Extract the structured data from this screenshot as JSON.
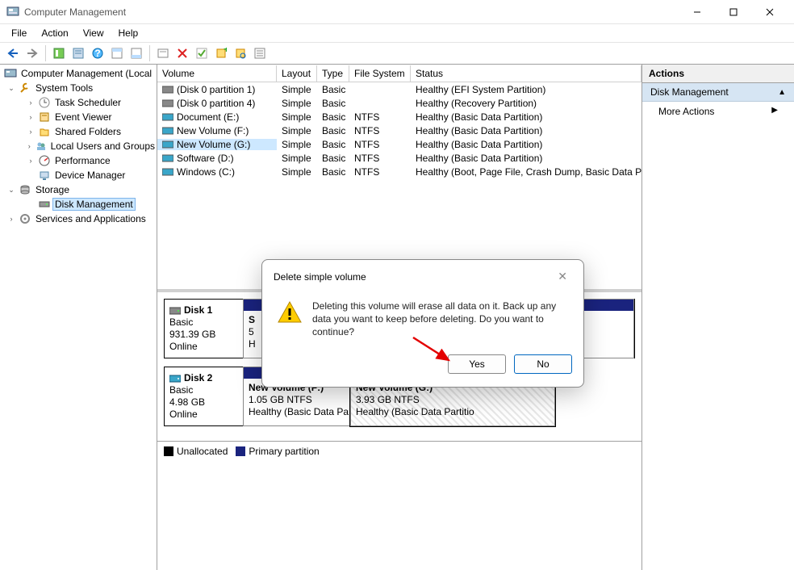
{
  "window": {
    "title": "Computer Management"
  },
  "menu": {
    "file": "File",
    "action": "Action",
    "view": "View",
    "help": "Help"
  },
  "tree": {
    "root": "Computer Management (Local",
    "systools": "System Tools",
    "taskscheduler": "Task Scheduler",
    "eventviewer": "Event Viewer",
    "sharedfolders": "Shared Folders",
    "localusers": "Local Users and Groups",
    "performance": "Performance",
    "devicemgr": "Device Manager",
    "storage": "Storage",
    "diskmgmt": "Disk Management",
    "services": "Services and Applications"
  },
  "cols": {
    "volume": "Volume",
    "layout": "Layout",
    "type": "Type",
    "fs": "File System",
    "status": "Status"
  },
  "vols": [
    {
      "name": "(Disk 0 partition 1)",
      "layout": "Simple",
      "type": "Basic",
      "fs": "",
      "status": "Healthy (EFI System Partition)",
      "icon": "drive"
    },
    {
      "name": "(Disk 0 partition 4)",
      "layout": "Simple",
      "type": "Basic",
      "fs": "",
      "status": "Healthy (Recovery Partition)",
      "icon": "drive"
    },
    {
      "name": "Document (E:)",
      "layout": "Simple",
      "type": "Basic",
      "fs": "NTFS",
      "status": "Healthy (Basic Data Partition)",
      "icon": "vol"
    },
    {
      "name": "New Volume (F:)",
      "layout": "Simple",
      "type": "Basic",
      "fs": "NTFS",
      "status": "Healthy (Basic Data Partition)",
      "icon": "vol"
    },
    {
      "name": "New Volume (G:)",
      "layout": "Simple",
      "type": "Basic",
      "fs": "NTFS",
      "status": "Healthy (Basic Data Partition)",
      "icon": "vol",
      "sel": true
    },
    {
      "name": "Software (D:)",
      "layout": "Simple",
      "type": "Basic",
      "fs": "NTFS",
      "status": "Healthy (Basic Data Partition)",
      "icon": "vol"
    },
    {
      "name": "Windows (C:)",
      "layout": "Simple",
      "type": "Basic",
      "fs": "NTFS",
      "status": "Healthy (Boot, Page File, Crash Dump, Basic Data Partition)",
      "icon": "vol"
    }
  ],
  "disks": {
    "d1": {
      "name": "Disk 1",
      "type": "Basic",
      "size": "931.39 GB",
      "state": "Online",
      "p1": {
        "name": "S",
        "line2": "5",
        "line3": "H"
      }
    },
    "d2": {
      "name": "Disk 2",
      "type": "Basic",
      "size": "4.98 GB",
      "state": "Online",
      "p1": {
        "name": "New Volume  (F:)",
        "line2": "1.05 GB NTFS",
        "line3": "Healthy (Basic Data Pa"
      },
      "p2": {
        "name": "New Volume  (G:)",
        "line2": "3.93 GB NTFS",
        "line3": "Healthy (Basic Data Partitio"
      }
    }
  },
  "legend": {
    "unalloc": "Unallocated",
    "primary": "Primary partition"
  },
  "actions": {
    "header": "Actions",
    "sub": "Disk Management",
    "more": "More Actions"
  },
  "dialog": {
    "title": "Delete simple volume",
    "message": "Deleting this volume will erase all data on it. Back up any data you want to keep before deleting. Do you want to continue?",
    "yes": "Yes",
    "no": "No"
  }
}
